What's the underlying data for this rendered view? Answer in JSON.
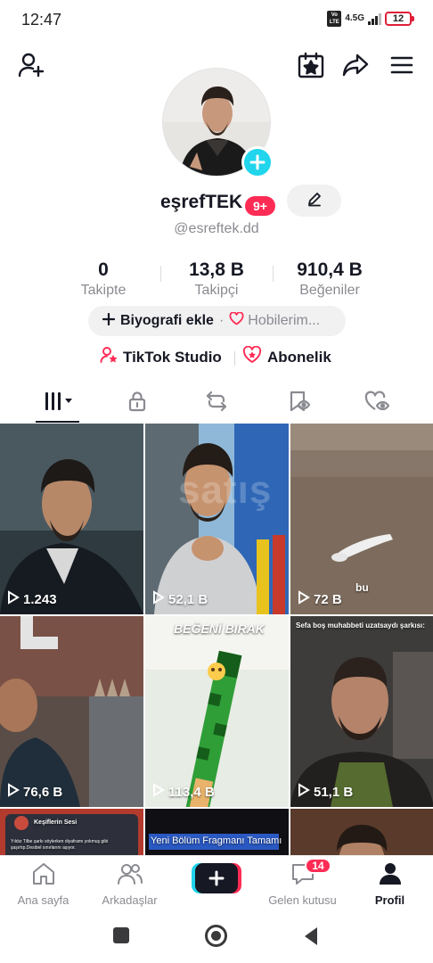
{
  "status_bar": {
    "time": "12:47",
    "network_badge": "Vo LTE",
    "network": "4.5G",
    "battery": "12"
  },
  "top_bar": {
    "icons": [
      "add-user-icon",
      "calendar-star-icon",
      "share-icon",
      "menu-icon"
    ]
  },
  "profile": {
    "username": "eşrefTEK",
    "notification_badge": "9+",
    "handle": "@esreftek.dd",
    "stats": [
      {
        "value": "0",
        "label": "Takipte"
      },
      {
        "value": "13,8 B",
        "label": "Takipçi"
      },
      {
        "value": "910,4 B",
        "label": "Beğeniler"
      }
    ],
    "bio_button": "Biyografi ekle",
    "hobbies_button": "Hobilerim...",
    "links": {
      "studio": "TikTok Studio",
      "subscription": "Abonelik"
    }
  },
  "tabs": [
    "videos-tab",
    "private-tab",
    "reposts-tab",
    "favorites-tab",
    "liked-tab"
  ],
  "videos": [
    {
      "views": "1.243"
    },
    {
      "views": "52,1 B"
    },
    {
      "views": "72 B",
      "caption": "bu"
    },
    {
      "views": "76,6 B"
    },
    {
      "views": "113,4 B",
      "caption": "BEĞENİ BIRAK"
    },
    {
      "views": "51,1 B",
      "caption": "Sefa boş muhabbeti uzatsaydı şarkısı:"
    },
    {
      "caption": "Keşiflerin Sesi",
      "subcaption": "Yıldız Tilbe şarkı söylerken diyaframı yokmuş gibi şaşırtıp.Desibel sınırlarını aşıyor."
    },
    {
      "caption": "Yeni Bölüm Fragmanı Tamamı"
    },
    {}
  ],
  "watermark": "satış",
  "bottom_nav": {
    "home": "Ana sayfa",
    "friends": "Arkadaşlar",
    "inbox": "Gelen kutusu",
    "inbox_badge": "14",
    "profile": "Profil"
  },
  "colors": {
    "accent": "#fe2c55",
    "cyan": "#20d5ec",
    "text": "#161823",
    "muted": "#8a8b91"
  }
}
